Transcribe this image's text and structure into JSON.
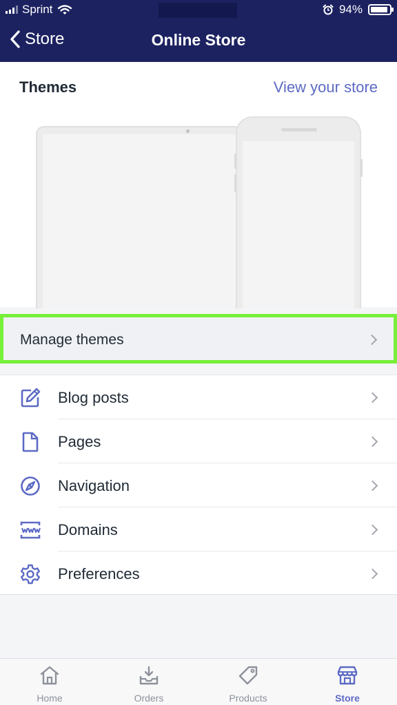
{
  "status_bar": {
    "carrier": "Sprint",
    "battery": "94%",
    "battery_level": 0.94
  },
  "header": {
    "back_label": "Store",
    "title": "Online Store"
  },
  "themes": {
    "title": "Themes",
    "view_store": "View your store",
    "manage_label": "Manage themes"
  },
  "menu": {
    "items": [
      {
        "label": "Blog posts",
        "icon": "edit-icon"
      },
      {
        "label": "Pages",
        "icon": "page-icon"
      },
      {
        "label": "Navigation",
        "icon": "compass-icon"
      },
      {
        "label": "Domains",
        "icon": "domain-icon"
      },
      {
        "label": "Preferences",
        "icon": "gear-icon"
      }
    ]
  },
  "tabs": [
    {
      "label": "Home",
      "icon": "home-icon",
      "active": false
    },
    {
      "label": "Orders",
      "icon": "inbox-icon",
      "active": false
    },
    {
      "label": "Products",
      "icon": "tag-icon",
      "active": false
    },
    {
      "label": "Store",
      "icon": "store-icon",
      "active": true
    }
  ],
  "colors": {
    "nav_bg": "#1c2260",
    "accent": "#5c6ac4",
    "highlight_border": "#77f03a"
  }
}
